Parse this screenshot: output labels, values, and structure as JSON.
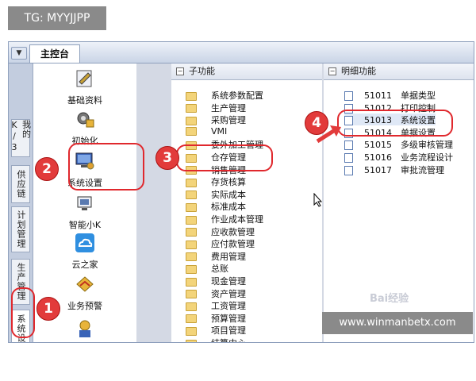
{
  "tag": "TG: MYYJJPP",
  "footer_site": "www.winmanbetx.com",
  "baidu_mark": "Bai",
  "baidu_mark_suffix": "经验",
  "tabbar": {
    "arrow": "▼",
    "main_tab": "主控台"
  },
  "side_tabs": [
    {
      "label": "我的K/3"
    },
    {
      "label": "供应链"
    },
    {
      "label": "计划管理"
    },
    {
      "label": "生产管理"
    },
    {
      "label": "系统设置"
    }
  ],
  "icons": [
    {
      "label": "基础资料",
      "icon": "database-icon"
    },
    {
      "label": "初始化",
      "icon": "gear-cube-icon"
    },
    {
      "label": "系统设置",
      "icon": "monitor-icon"
    },
    {
      "label": "智能小K",
      "icon": "robot-icon"
    },
    {
      "label": "云之家",
      "icon": "cloud-icon"
    },
    {
      "label": "业务预警",
      "icon": "alert-icon"
    }
  ],
  "sub_panel": {
    "title": "子功能"
  },
  "sub_items": [
    "系统参数配置",
    "生产管理",
    "采购管理",
    "VMI",
    "委外加工管理",
    "仓存管理",
    "销售管理",
    "存货核算",
    "实际成本",
    "标准成本",
    "作业成本管理",
    "应收款管理",
    "应付款管理",
    "费用管理",
    "总账",
    "现金管理",
    "资产管理",
    "工资管理",
    "预算管理",
    "项目管理",
    "结算中心"
  ],
  "detail_panel": {
    "title": "明细功能"
  },
  "detail_items": [
    {
      "code": "51011",
      "name": "单据类型"
    },
    {
      "code": "51012",
      "name": "打印控制"
    },
    {
      "code": "51013",
      "name": "系统设置"
    },
    {
      "code": "51014",
      "name": "单据设置"
    },
    {
      "code": "51015",
      "name": "多级审核管理"
    },
    {
      "code": "51016",
      "name": "业务流程设计"
    },
    {
      "code": "51017",
      "name": "审批流管理"
    }
  ],
  "steps": [
    "1",
    "2",
    "3",
    "4"
  ],
  "colors": {
    "accent_red": "#e23b3b",
    "panel_bg": "#d4d9e4",
    "folder": "#f3d47a"
  }
}
